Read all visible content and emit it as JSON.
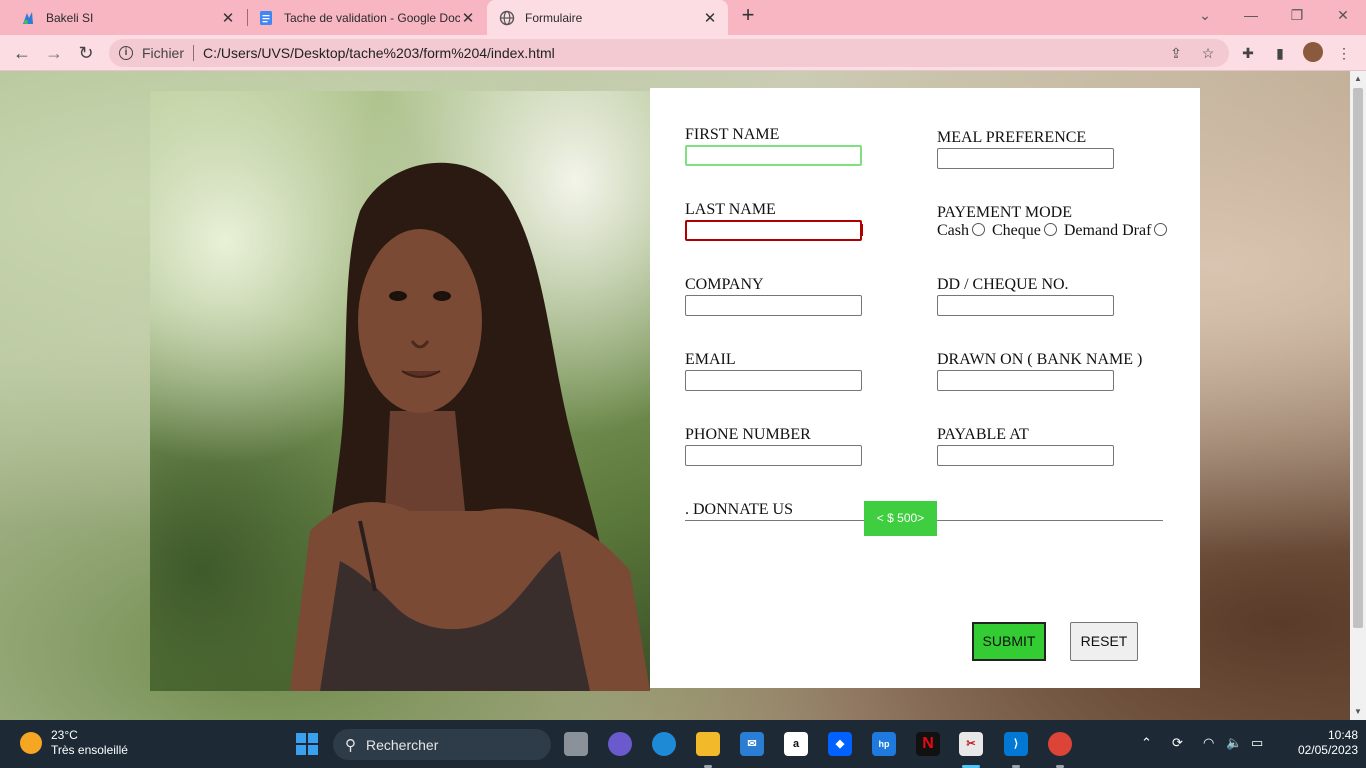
{
  "tabs": [
    {
      "title": "Bakeli SI"
    },
    {
      "title": "Tache de validation - Google Doc"
    },
    {
      "title": "Formulaire"
    }
  ],
  "address": {
    "scheme_label": "Fichier",
    "url": "C:/Users/UVS/Desktop/tache%203/form%204/index.html"
  },
  "form": {
    "first_name": "FIRST NAME",
    "last_name": "LAST NAME",
    "company": "COMPANY",
    "email": "EMAIL",
    "phone": "PHONE NUMBER",
    "meal": "MEAL PREFERENCE",
    "payment_mode": "PAYEMENT MODE",
    "payment_options": [
      "Cash",
      "Cheque",
      "Demand Draf"
    ],
    "cheque_no": "DD / CHEQUE NO.",
    "drawn_on": "DRAWN ON ( BANK NAME )",
    "payable_at": "PAYABLE AT",
    "donate_label": ". DONNATE US",
    "donate_value": "< $ 500>",
    "submit": "SUBMIT",
    "reset": "RESET"
  },
  "taskbar": {
    "temperature": "23°C",
    "weather": "Très ensoleillé",
    "search_placeholder": "Rechercher",
    "time": "10:48",
    "date": "02/05/2023"
  },
  "colors": {
    "tabbar": "#f7b6c1",
    "active_tab": "#fbdde3",
    "green_accent": "#33cc33",
    "error_red": "#b00000"
  }
}
